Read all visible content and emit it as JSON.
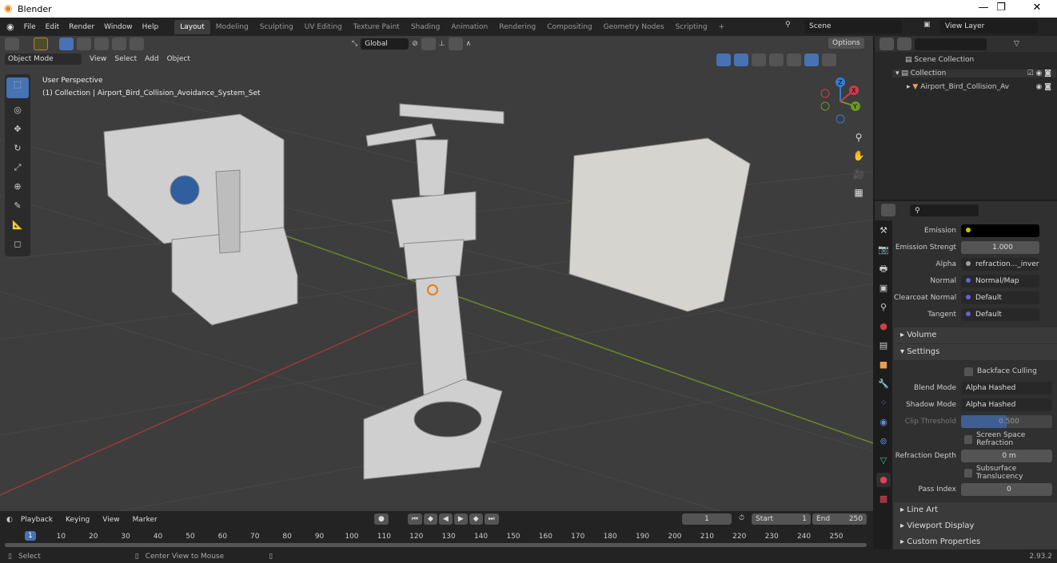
{
  "window": {
    "title": "Blender",
    "minimize": "—",
    "maximize": "❐",
    "close": "✕"
  },
  "menu": [
    "File",
    "Edit",
    "Render",
    "Window",
    "Help"
  ],
  "workspaces": [
    "Layout",
    "Modeling",
    "Sculpting",
    "UV Editing",
    "Texture Paint",
    "Shading",
    "Animation",
    "Rendering",
    "Compositing",
    "Geometry Nodes",
    "Scripting"
  ],
  "active_workspace": "Layout",
  "add_tab": "+",
  "scene": {
    "name": "Scene",
    "view_layer": "View Layer"
  },
  "toolbar": {
    "transform_orientation": "Global",
    "options": "Options"
  },
  "viewport": {
    "mode": "Object Mode",
    "menus": [
      "View",
      "Select",
      "Add",
      "Object"
    ],
    "perspective": "User Perspective",
    "context": "(1) Collection | Airport_Bird_Collision_Avoidance_System_Set",
    "gizmo": {
      "x": "X",
      "y": "Y",
      "z": "Z"
    }
  },
  "outliner": {
    "search_placeholder": "",
    "items": [
      {
        "label": "Scene Collection"
      },
      {
        "label": "Collection"
      },
      {
        "label": "Airport_Bird_Collision_Av"
      }
    ]
  },
  "properties": {
    "rows": [
      {
        "label": "Emission",
        "value": "",
        "socket": "#c8c800",
        "color": "#000000"
      },
      {
        "label": "Emission Strengt",
        "value": "1.000",
        "socket": "#a0a0a0"
      },
      {
        "label": "Alpha",
        "value": "refraction..._invert.pn",
        "socket": "#a0a0a0",
        "expand": true
      },
      {
        "label": "Normal",
        "value": "Normal/Map",
        "socket": "#6363c7",
        "expand": true
      },
      {
        "label": "Clearcoat Normal",
        "value": "Default",
        "socket": "#6363c7"
      },
      {
        "label": "Tangent",
        "value": "Default",
        "socket": "#6363c7"
      }
    ],
    "sections": {
      "volume": "Volume",
      "settings": "Settings",
      "line_art": "Line Art",
      "viewport_display": "Viewport Display",
      "custom_properties": "Custom Properties"
    },
    "settings": {
      "backface_culling": {
        "label": "Backface Culling",
        "checked": false
      },
      "blend_mode": {
        "label": "Blend Mode",
        "value": "Alpha Hashed"
      },
      "shadow_mode": {
        "label": "Shadow Mode",
        "value": "Alpha Hashed"
      },
      "clip_threshold": {
        "label": "Clip Threshold",
        "value": "0.500",
        "fraction": 0.5
      },
      "screen_space_refraction": {
        "label": "Screen Space Refraction",
        "checked": false
      },
      "refraction_depth": {
        "label": "Refraction Depth",
        "value": "0 m"
      },
      "subsurface_translucency": {
        "label": "Subsurface Translucency",
        "checked": false
      },
      "pass_index": {
        "label": "Pass Index",
        "value": "0"
      }
    }
  },
  "timeline": {
    "menus": [
      "Playback",
      "Keying",
      "View",
      "Marker"
    ],
    "current_frame": "1",
    "start_label": "Start",
    "start": "1",
    "end_label": "End",
    "end": "250",
    "ticks": [
      "10",
      "20",
      "30",
      "40",
      "50",
      "60",
      "70",
      "80",
      "90",
      "100",
      "110",
      "120",
      "130",
      "140",
      "150",
      "160",
      "170",
      "180",
      "190",
      "200",
      "210",
      "220",
      "230",
      "240",
      "250"
    ],
    "playhead": "1"
  },
  "status": {
    "select": "Select",
    "center": "Center View to Mouse",
    "version": "2.93.2"
  },
  "colors": {
    "accent": "#4772b3",
    "bg": "#3d3d3d",
    "panel": "#303030"
  }
}
